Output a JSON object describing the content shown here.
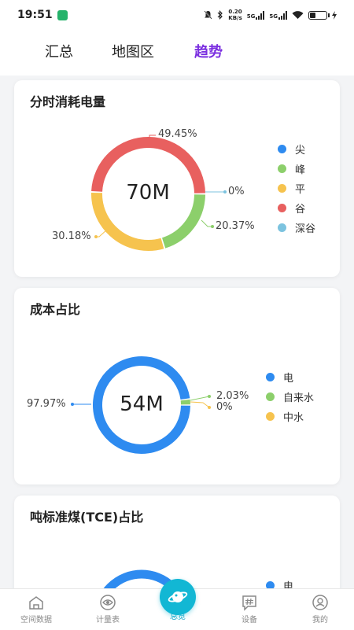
{
  "status_bar": {
    "time": "19:51",
    "net_speed_value": "0.20",
    "net_speed_unit": "KB/s",
    "signal1_label": "5G",
    "signal2_label": "5G",
    "battery_level": 0.35
  },
  "tabs": [
    {
      "label": "汇总",
      "active": false
    },
    {
      "label": "地图区",
      "active": false
    },
    {
      "label": "趋势",
      "active": true
    }
  ],
  "cards": {
    "hourly_consumption": {
      "title": "分时消耗电量",
      "center_value": "70M",
      "labels": {
        "jian": "0%",
        "feng": "20.37%",
        "ping": "30.18%",
        "gu": "49.45%"
      },
      "legend": [
        "尖",
        "峰",
        "平",
        "谷",
        "深谷"
      ],
      "colors": [
        "#2e8bf0",
        "#8ccf6b",
        "#f6c34e",
        "#e8605f",
        "#7cc3df"
      ],
      "chart_data": {
        "type": "pie",
        "categories": [
          "尖",
          "峰",
          "平",
          "谷",
          "深谷"
        ],
        "values": [
          0,
          20.37,
          30.18,
          49.45,
          0
        ]
      }
    },
    "cost_share": {
      "title": "成本占比",
      "center_value": "54M",
      "labels": {
        "dian": "97.97%",
        "zilaishui": "2.03%",
        "zhongshui": "0%"
      },
      "legend": [
        "电",
        "自来水",
        "中水"
      ],
      "colors": [
        "#2e8bf0",
        "#8ccf6b",
        "#f6c34e"
      ],
      "chart_data": {
        "type": "pie",
        "categories": [
          "电",
          "自来水",
          "中水"
        ],
        "values": [
          97.97,
          2.03,
          0
        ]
      }
    },
    "coal_share": {
      "title": "吨标准煤(TCE)占比",
      "legend": [
        "电"
      ],
      "colors": [
        "#2e8bf0"
      ]
    }
  },
  "bottom_nav": [
    {
      "label": "空间数据",
      "icon": "home-icon"
    },
    {
      "label": "计量表",
      "icon": "eye-icon"
    },
    {
      "label": "总览",
      "icon": "planet-icon",
      "active": true
    },
    {
      "label": "设备",
      "icon": "hash-icon"
    },
    {
      "label": "我的",
      "icon": "user-icon"
    }
  ]
}
